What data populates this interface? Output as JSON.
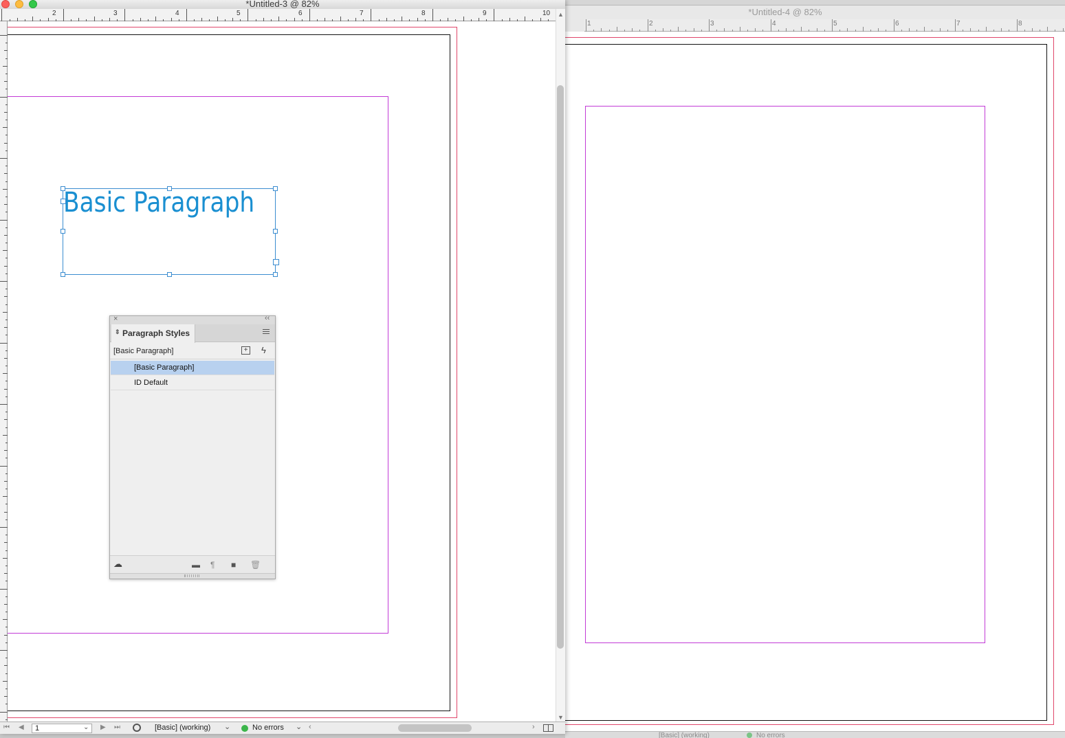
{
  "front_window": {
    "title": "*Untitled-3 @ 82%",
    "ruler_labels": [
      "2",
      "3",
      "4",
      "5",
      "6",
      "7",
      "8",
      "9",
      "10"
    ],
    "text_frame": {
      "text": "Basic Paragraph",
      "color": "#1a8fd1"
    },
    "status": {
      "page_value": "1",
      "profile": "[Basic] (working)",
      "preflight": "No errors",
      "preflight_color": "#3bb54a"
    }
  },
  "back_window": {
    "title": "*Untitled-4 @ 82%",
    "ruler_labels": [
      "1",
      "2",
      "3",
      "4",
      "5",
      "6",
      "7",
      "8"
    ],
    "status": {
      "profile": "[Basic] (working)",
      "preflight": "No errors"
    }
  },
  "panel": {
    "tab_label": "Paragraph Styles",
    "current_style": "[Basic Paragraph]",
    "styles": [
      {
        "label": "[Basic Paragraph]",
        "selected": true
      },
      {
        "label": "ID Default",
        "selected": false
      }
    ]
  },
  "colors": {
    "margin_guide": "#c23ad6",
    "bleed_guide": "#e0466a",
    "selection": "#3a8cd0",
    "row_selected": "#b8d1ef"
  },
  "icons": [
    "close-icon",
    "collapse-icon",
    "panel-menu-icon",
    "new-group-from-style-icon",
    "quick-apply-icon",
    "cloud-library-icon",
    "folder-icon",
    "clear-overrides-icon",
    "new-style-icon",
    "trash-icon"
  ]
}
